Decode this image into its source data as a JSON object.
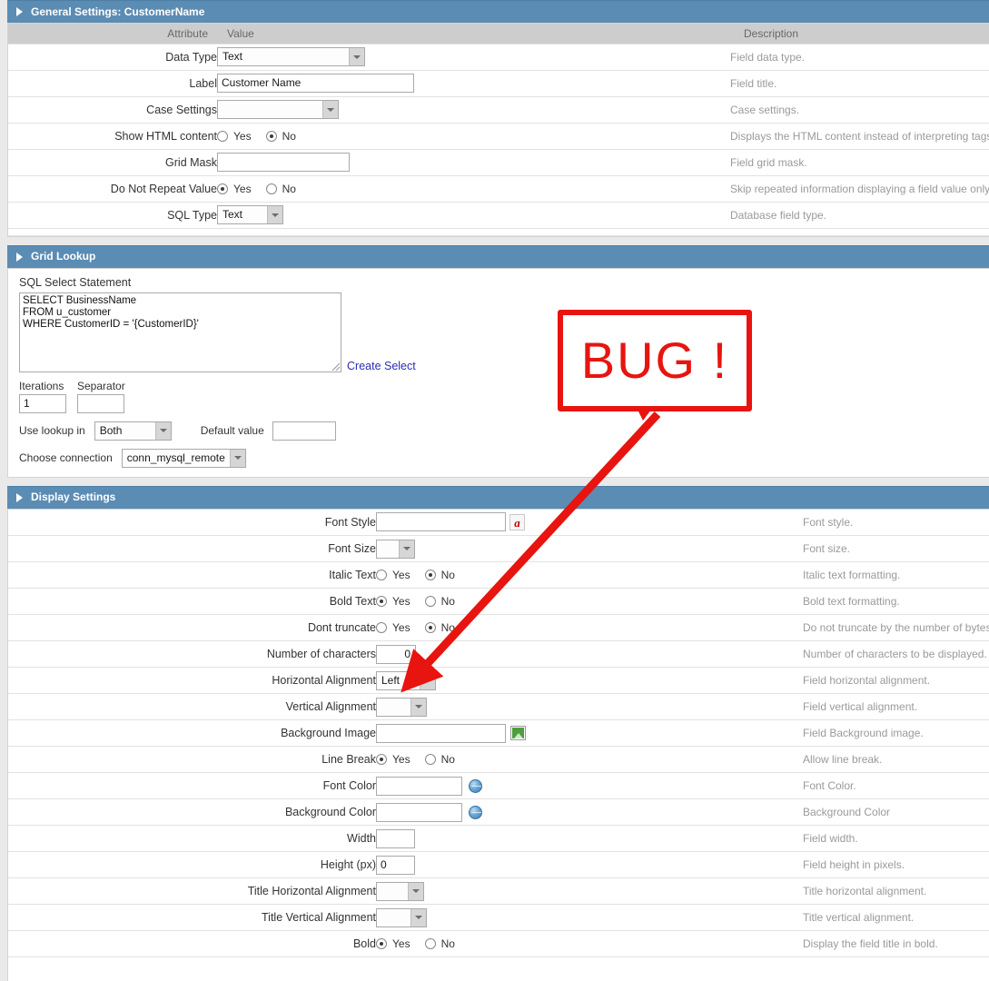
{
  "general": {
    "section_title": "General Settings: CustomerName",
    "columns": {
      "attribute": "Attribute",
      "value": "Value",
      "description": "Description"
    },
    "rows": [
      {
        "attribute": "Data Type",
        "control": "select",
        "value": "Text",
        "description": "Field data type."
      },
      {
        "attribute": "Label",
        "control": "text",
        "value": "Customer Name",
        "description": "Field title."
      },
      {
        "attribute": "Case Settings",
        "control": "select",
        "value": "",
        "description": "Case settings."
      },
      {
        "attribute": "Show HTML content",
        "control": "radio",
        "value": "No",
        "yes_label": "Yes",
        "no_label": "No",
        "description": "Displays the HTML content instead of interpreting tags"
      },
      {
        "attribute": "Grid Mask",
        "control": "text",
        "value": "",
        "description": "Field grid mask."
      },
      {
        "attribute": "Do Not Repeat Value",
        "control": "radio",
        "value": "Yes",
        "yes_label": "Yes",
        "no_label": "No",
        "description": "Skip repeated information displaying a field value only"
      },
      {
        "attribute": "SQL Type",
        "control": "select",
        "value": "Text",
        "description": "Database field type."
      }
    ]
  },
  "grid_lookup": {
    "section_title": "Grid Lookup",
    "sql_label": "SQL Select Statement",
    "sql_value": "SELECT BusinessName\nFROM u_customer\nWHERE CustomerID = '{CustomerID}'",
    "create_select_label": "Create Select",
    "iterations_label": "Iterations",
    "iterations_value": "1",
    "separator_label": "Separator",
    "separator_value": "",
    "use_lookup_label": "Use lookup in",
    "use_lookup_value": "Both",
    "default_value_label": "Default value",
    "default_value": "",
    "connection_label": "Choose connection",
    "connection_value": "conn_mysql_remote"
  },
  "display": {
    "section_title": "Display Settings",
    "rows": [
      {
        "attribute": "Font Style",
        "control": "text-icon",
        "value": "",
        "icon": "font-style-icon",
        "description": "Font style."
      },
      {
        "attribute": "Font Size",
        "control": "select",
        "value": "",
        "description": "Font size."
      },
      {
        "attribute": "Italic Text",
        "control": "radio",
        "value": "No",
        "yes_label": "Yes",
        "no_label": "No",
        "description": "Italic text formatting."
      },
      {
        "attribute": "Bold Text",
        "control": "radio",
        "value": "Yes",
        "yes_label": "Yes",
        "no_label": "No",
        "description": "Bold text formatting."
      },
      {
        "attribute": "Dont truncate",
        "control": "radio",
        "value": "No",
        "yes_label": "Yes",
        "no_label": "No",
        "description": "Do not truncate by the number of bytes"
      },
      {
        "attribute": "Number of characters",
        "control": "num",
        "value": "0",
        "description": "Number of characters to be displayed."
      },
      {
        "attribute": "Horizontal Alignment",
        "control": "select",
        "value": "Left",
        "description": "Field horizontal alignment."
      },
      {
        "attribute": "Vertical Alignment",
        "control": "select",
        "value": "",
        "description": "Field vertical alignment."
      },
      {
        "attribute": "Background Image",
        "control": "text-image",
        "value": "",
        "icon": "image-picker-icon",
        "description": "Field Background image."
      },
      {
        "attribute": "Line Break",
        "control": "radio",
        "value": "Yes",
        "yes_label": "Yes",
        "no_label": "No",
        "description": "Allow line break."
      },
      {
        "attribute": "Font Color",
        "control": "text-globe",
        "value": "",
        "icon": "color-picker-icon",
        "description": "Font Color."
      },
      {
        "attribute": "Background Color",
        "control": "text-globe",
        "value": "",
        "icon": "color-picker-icon",
        "description": "Background Color"
      },
      {
        "attribute": "Width",
        "control": "text",
        "value": "",
        "description": "Field width."
      },
      {
        "attribute": "Height (px)",
        "control": "text",
        "value": "0",
        "description": "Field height in pixels."
      },
      {
        "attribute": "Title Horizontal Alignment",
        "control": "select",
        "value": "",
        "description": "Title horizontal alignment."
      },
      {
        "attribute": "Title Vertical Alignment",
        "control": "select",
        "value": "",
        "description": "Title vertical alignment."
      },
      {
        "attribute": "Bold",
        "control": "radio",
        "value": "Yes",
        "yes_label": "Yes",
        "no_label": "No",
        "description": "Display the field title in bold."
      }
    ]
  },
  "annotation": {
    "bug_label": "BUG !",
    "color": "#e8140f"
  },
  "theme": {
    "header_blue": "#5b8cb4",
    "column_header_gray": "#cdcdcd",
    "link_blue": "#2b2bbb",
    "description_gray": "#9a9a9a"
  }
}
